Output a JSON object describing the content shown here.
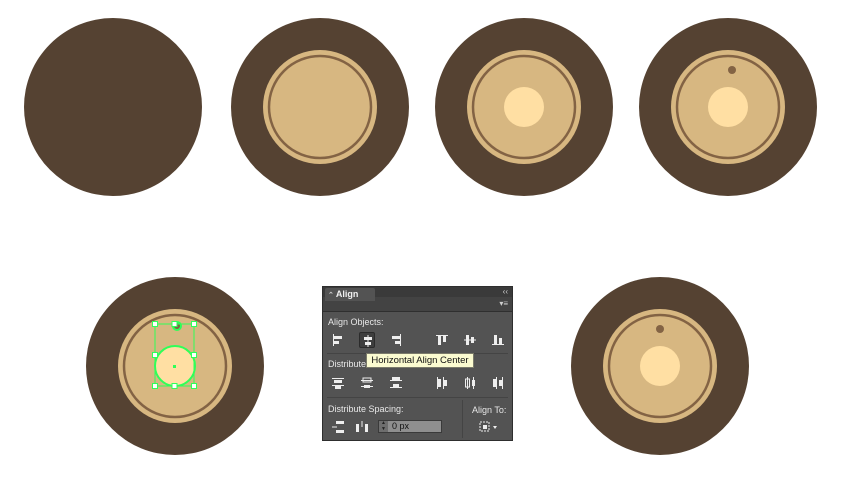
{
  "colors": {
    "outer_disc": "#554232",
    "inner_disc": "#d7b781",
    "ring": "#836344",
    "center_light": "#ffdfa3",
    "selection": "#2fff58",
    "panel_bg": "#535353",
    "tooltip_bg": "#fbfbd0"
  },
  "panel": {
    "close_glyph": "✕",
    "collapse_glyph": "‹‹",
    "tab_arrows_glyph": "⌃",
    "tab_label": "Align",
    "menu_glyph": "▾≡",
    "align_objects_label": "Align Objects:",
    "distribute_objects_label": "Distribute",
    "distribute_spacing_label": "Distribute Spacing:",
    "align_to_label": "Align To:",
    "spacing_value": "0 px",
    "align_objects_icons": [
      "align-left-icon",
      "align-horizontal-center-icon",
      "align-right-icon",
      "align-top-icon",
      "align-vertical-center-icon",
      "align-bottom-icon"
    ],
    "distribute_objects_icons": [
      "distribute-top-icon",
      "distribute-vertical-center-icon",
      "distribute-bottom-icon",
      "distribute-left-icon",
      "distribute-horizontal-center-icon",
      "distribute-right-icon"
    ],
    "distribute_spacing_icons": [
      "distribute-vertical-spacing-icon",
      "distribute-horizontal-spacing-icon"
    ],
    "align_to_icon": "align-to-key-object-icon"
  },
  "tooltip": {
    "text": "Horizontal Align Center"
  }
}
